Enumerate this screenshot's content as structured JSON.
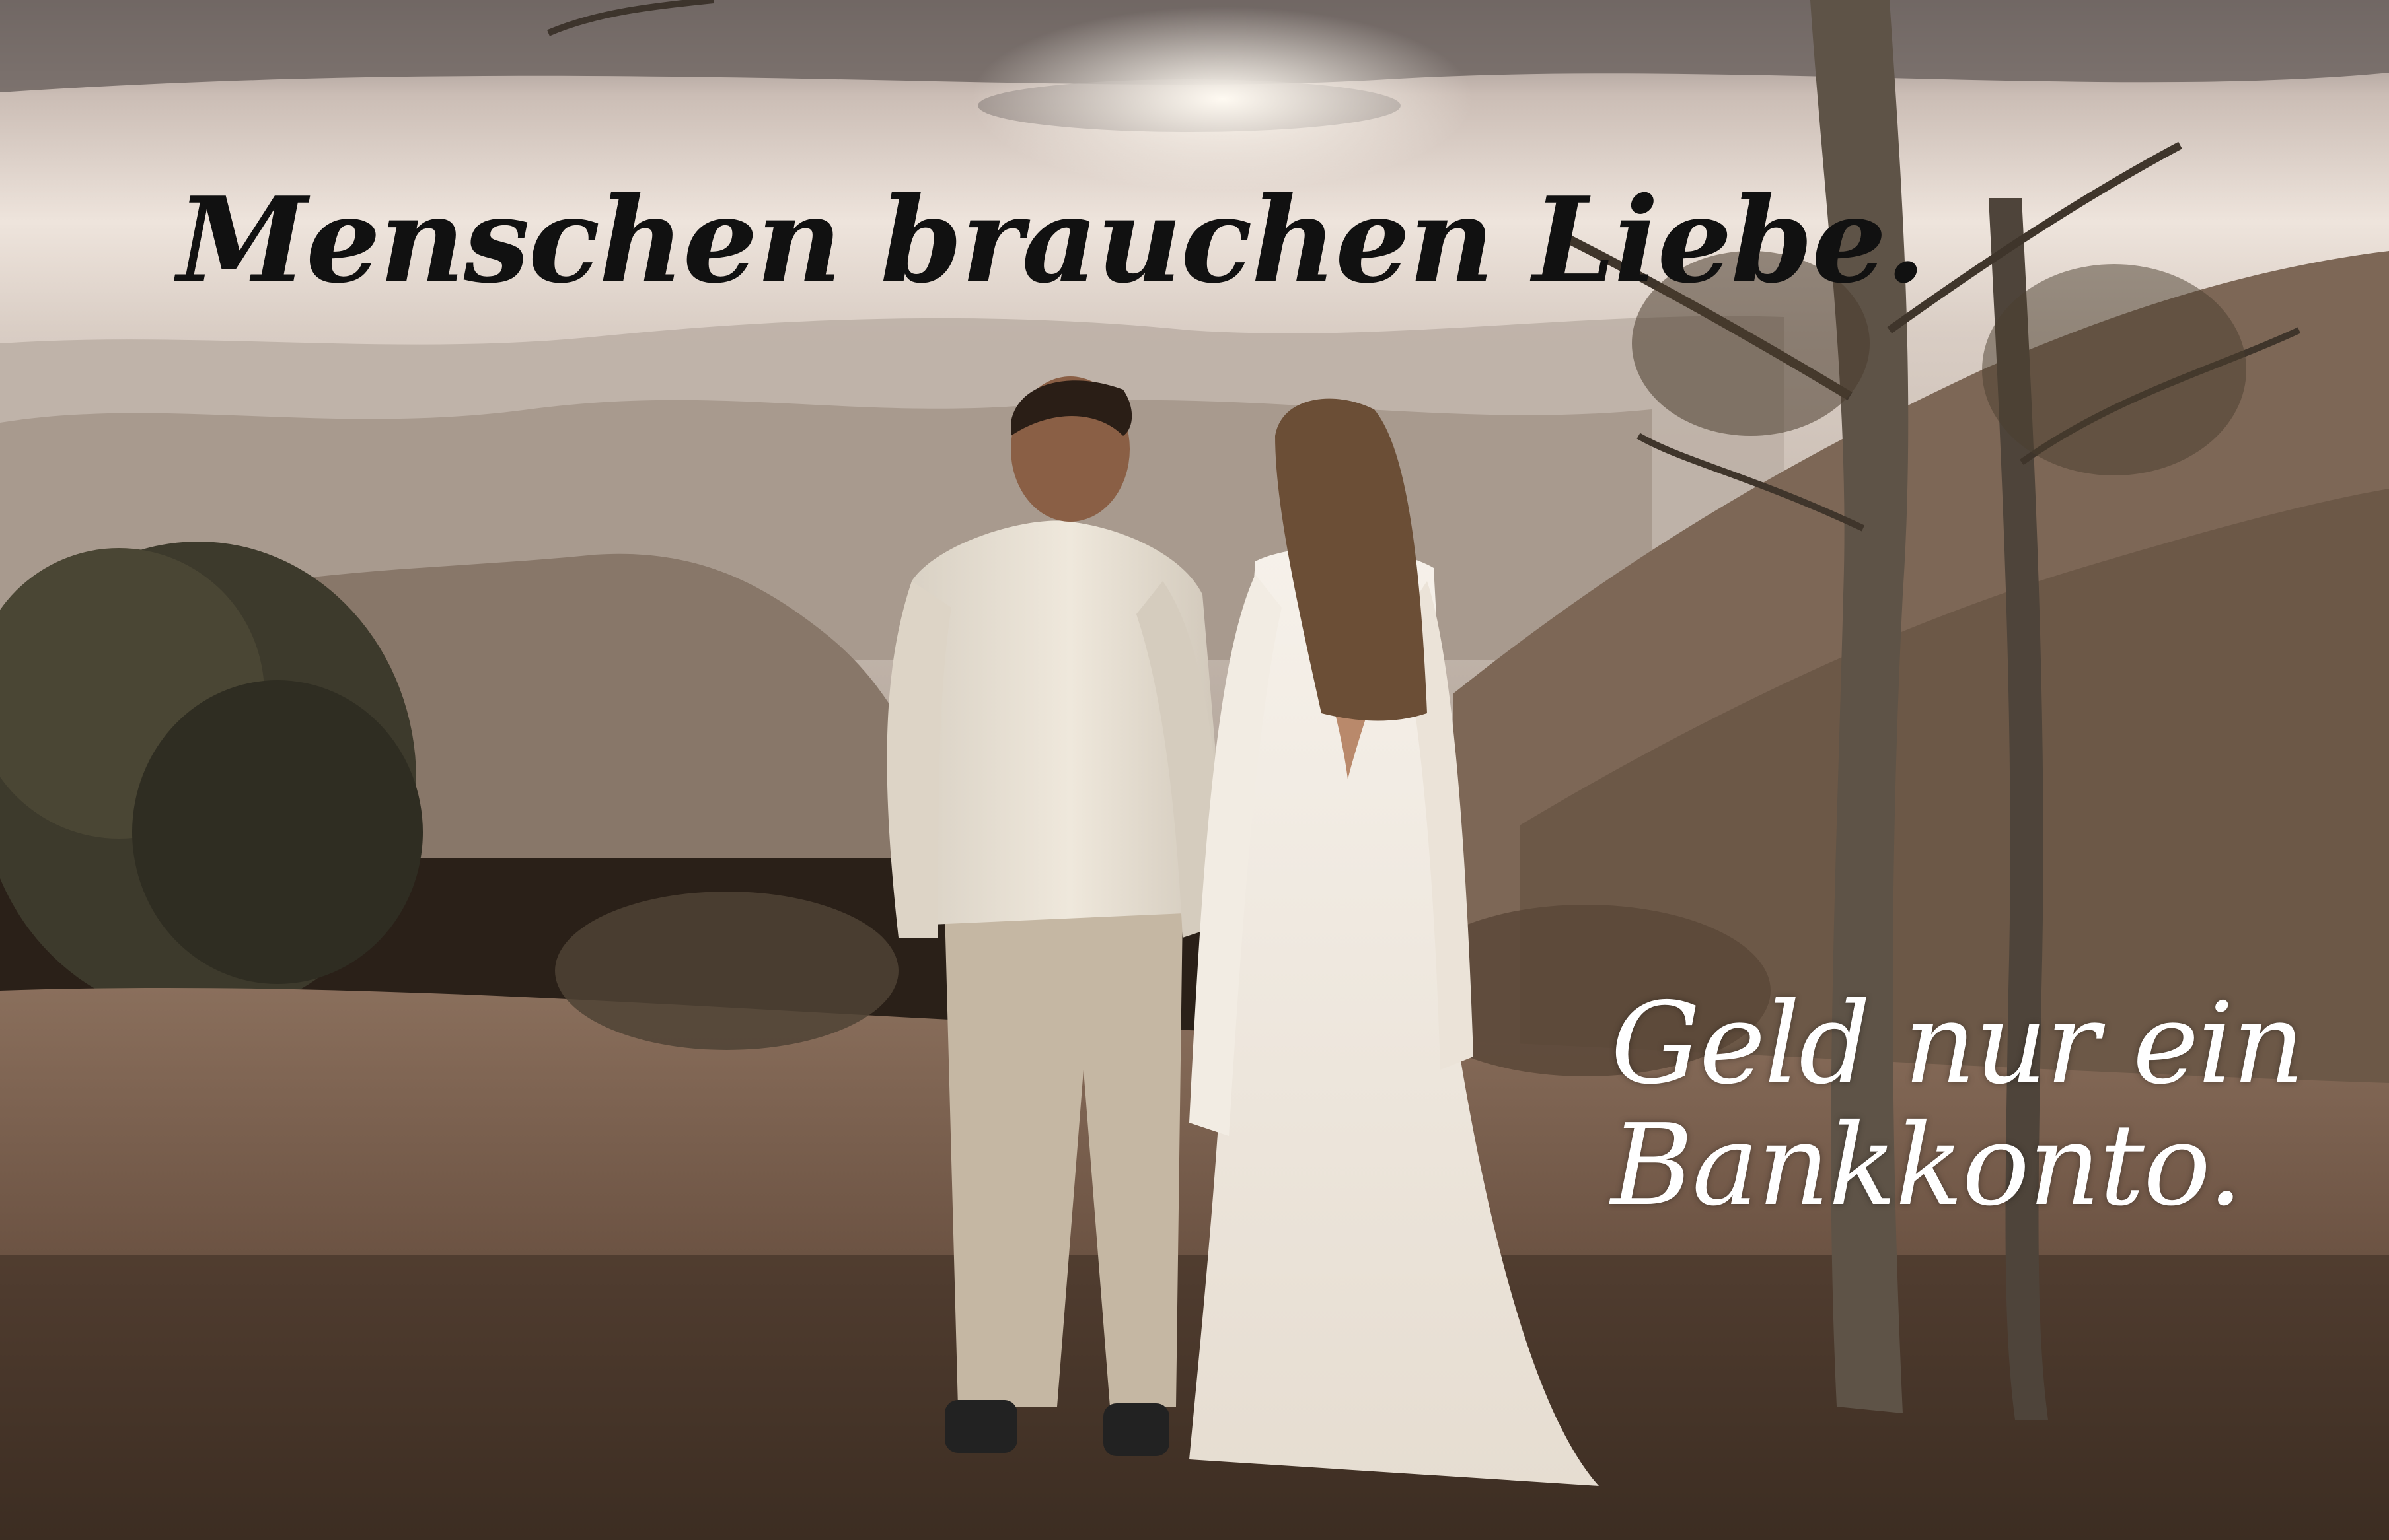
{
  "quote": {
    "line1": "Menschen brauchen Liebe.",
    "line2": "Geld nur ein",
    "line3": "Bankkonto."
  },
  "colors": {
    "top_text": "#111111",
    "bottom_text": "#ffffff",
    "sky": "#e6dcd4",
    "ground": "#6b5444"
  }
}
